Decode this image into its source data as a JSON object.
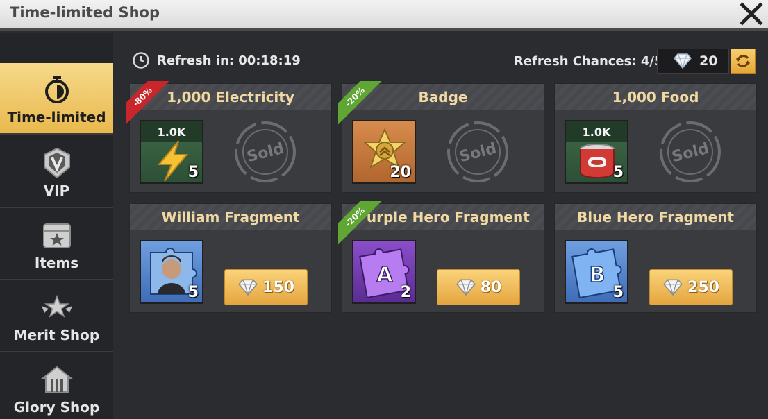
{
  "window": {
    "title": "Time-limited Shop"
  },
  "sidebar": {
    "items": [
      {
        "label": "Time-limited",
        "icon": "stopwatch-icon",
        "active": true
      },
      {
        "label": "VIP",
        "icon": "vip-shield-icon"
      },
      {
        "label": "Items",
        "icon": "chest-icon"
      },
      {
        "label": "Merit Shop",
        "icon": "star-wings-icon"
      },
      {
        "label": "Glory Shop",
        "icon": "house-icon"
      }
    ]
  },
  "header": {
    "refresh_label": "Refresh in: 00:18:19",
    "chances_label": "Refresh Chances: 4/5",
    "gems": "20"
  },
  "cards": [
    {
      "title": "1,000 Electricity",
      "tile_top": "1.0K",
      "qty": "5",
      "badge": "-80%",
      "badge_color": "#c8262a",
      "sold_text": "Sold",
      "icon": "lightning-icon"
    },
    {
      "title": "Badge",
      "qty": "20",
      "badge": "-20%",
      "badge_color": "#5fa634",
      "sold_text": "Sold",
      "icon": "sheriff-badge-icon"
    },
    {
      "title": "1,000 Food",
      "tile_top": "1.0K",
      "qty": "5",
      "sold_text": "Sold",
      "icon": "food-can-icon"
    },
    {
      "title": "William Fragment",
      "qty": "5",
      "price": "150",
      "icon": "portrait-puzzle-icon"
    },
    {
      "title": "Purple Hero Fragment",
      "qty": "2",
      "price": "80",
      "badge": "-20%",
      "badge_color": "#5fa634",
      "tile_letter": "A",
      "icon": "purple-puzzle-icon"
    },
    {
      "title": "Blue Hero Fragment",
      "qty": "5",
      "price": "250",
      "tile_letter": "B",
      "icon": "blue-puzzle-icon"
    }
  ]
}
